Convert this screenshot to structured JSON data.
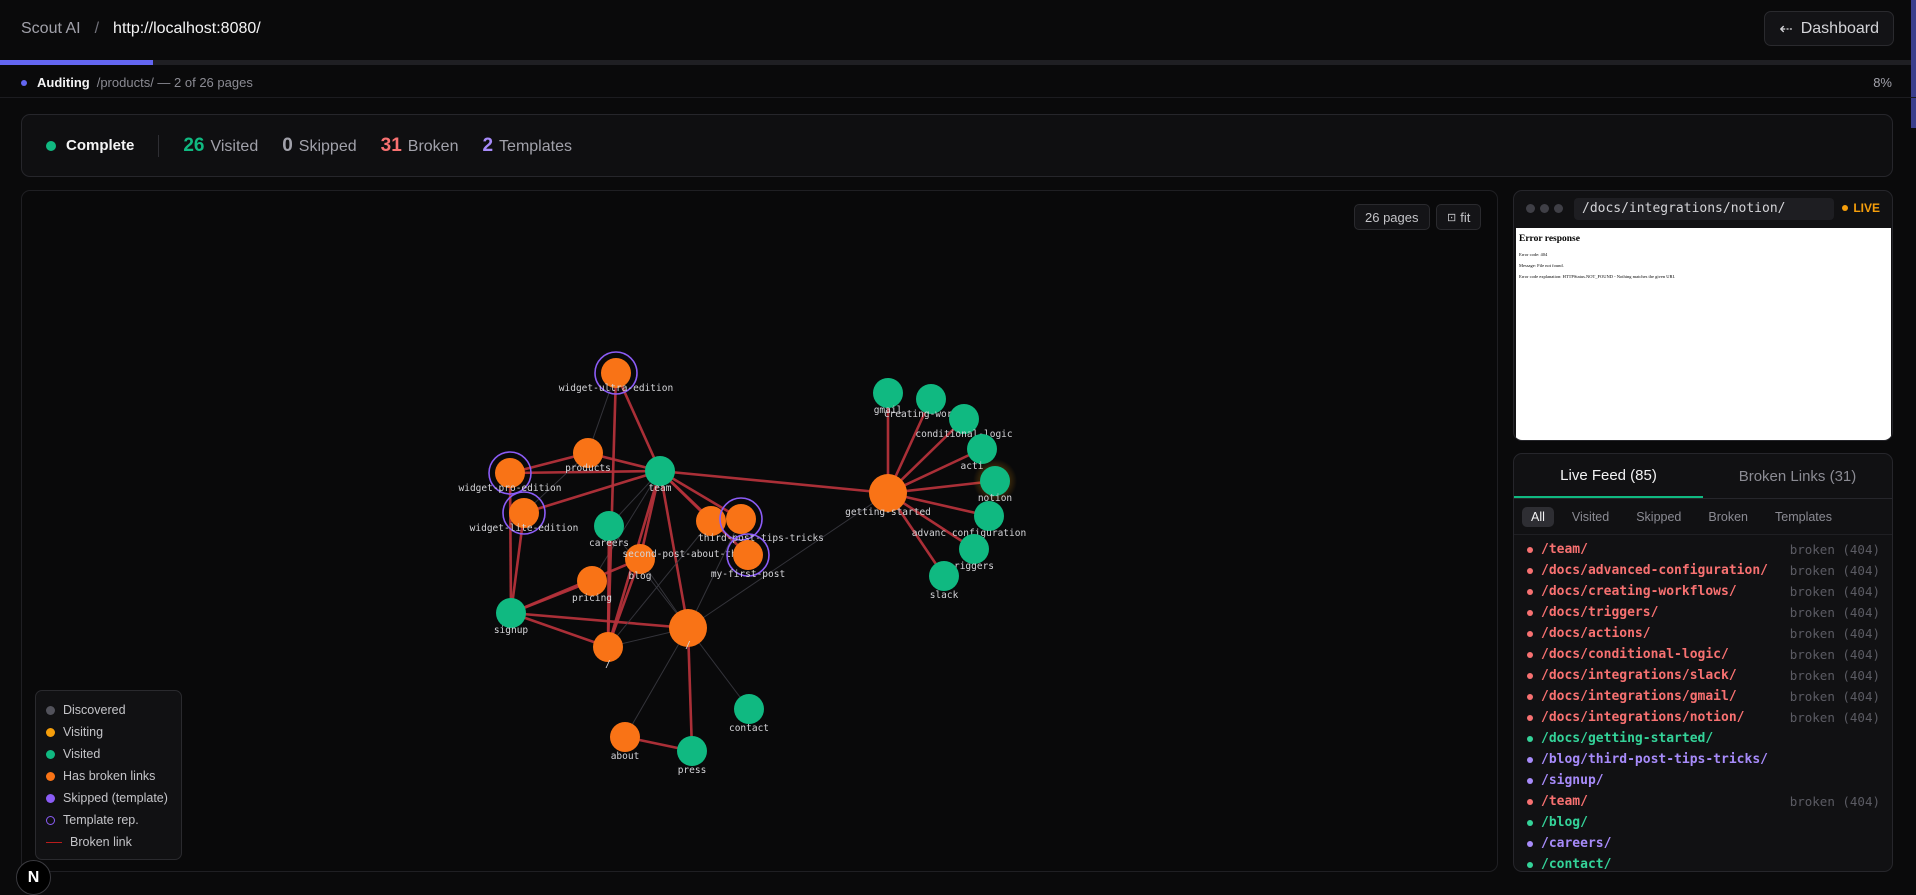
{
  "header": {
    "app": "Scout AI",
    "sep": "/",
    "url": "http://localhost:8080/",
    "dashboard_label": "Dashboard",
    "progress_fraction": 0.08
  },
  "audit": {
    "label": "Auditing",
    "path": "/products/ — 2 of 26 pages",
    "percent": "8%"
  },
  "stats": {
    "status": "Complete",
    "items": [
      {
        "num": "26",
        "label": "Visited",
        "color": "#10b981"
      },
      {
        "num": "0",
        "label": "Skipped",
        "color": "#a1a1aa"
      },
      {
        "num": "31",
        "label": "Broken",
        "color": "#f87171"
      },
      {
        "num": "2",
        "label": "Templates",
        "color": "#a78bfa"
      }
    ]
  },
  "graph": {
    "pages_label": "26 pages",
    "fit_label": "fit",
    "nodes": [
      {
        "id": "widget-ultra-edition",
        "kind": "broken",
        "template": true
      },
      {
        "id": "products",
        "kind": "broken"
      },
      {
        "id": "team",
        "kind": "visited"
      },
      {
        "id": "widget-pro-edition",
        "kind": "broken",
        "template": true
      },
      {
        "id": "widget-lite-edition",
        "kind": "broken",
        "template": true
      },
      {
        "id": "careers",
        "kind": "visited"
      },
      {
        "id": "blog",
        "kind": "broken"
      },
      {
        "id": "second-post-about-things",
        "kind": "broken"
      },
      {
        "id": "third-post-tips-tricks",
        "kind": "broken",
        "template": true
      },
      {
        "id": "my-first-post",
        "kind": "broken",
        "template": true
      },
      {
        "id": "pricing",
        "kind": "broken"
      },
      {
        "id": "signup",
        "kind": "visited"
      },
      {
        "id": "/",
        "kind": "broken"
      },
      {
        "id": "/root",
        "display": "/",
        "kind": "broken"
      },
      {
        "id": "contact",
        "kind": "visited"
      },
      {
        "id": "about",
        "kind": "broken"
      },
      {
        "id": "press",
        "kind": "visited"
      },
      {
        "id": "getting-started",
        "kind": "broken"
      },
      {
        "id": "gmail",
        "kind": "visited"
      },
      {
        "id": "creating-workflows",
        "display": "creating-work",
        "kind": "visited"
      },
      {
        "id": "conditional-logic",
        "kind": "visited"
      },
      {
        "id": "actions",
        "display": "acti",
        "kind": "visited"
      },
      {
        "id": "notion",
        "kind": "visited",
        "live": true
      },
      {
        "id": "advanced-configuration",
        "display": "advanc   configuration",
        "kind": "visited"
      },
      {
        "id": "triggers",
        "display": "riggers",
        "kind": "visited"
      },
      {
        "id": "slack",
        "kind": "visited"
      }
    ],
    "legend": [
      {
        "label": "Discovered",
        "color": "#52525b",
        "type": "dot"
      },
      {
        "label": "Visiting",
        "color": "#f59e0b",
        "type": "dot"
      },
      {
        "label": "Visited",
        "color": "#10b981",
        "type": "dot"
      },
      {
        "label": "Has broken links",
        "color": "#f97316",
        "type": "dot"
      },
      {
        "label": "Skipped (template)",
        "color": "#8b5cf6",
        "type": "dot"
      },
      {
        "label": "Template rep.",
        "color": "#8b5cf6",
        "type": "ring"
      },
      {
        "label": "Broken link",
        "color": "#b91c1c",
        "type": "line"
      }
    ]
  },
  "preview": {
    "url": "/docs/integrations/notion/",
    "live": "LIVE",
    "heading": "Error response",
    "lines": [
      "Error code: 404",
      "Message: File not found.",
      "Error code explanation: HTTPStatus.NOT_FOUND - Nothing matches the given URI."
    ]
  },
  "feed": {
    "tabs": [
      "Live Feed (85)",
      "Broken Links (31)"
    ],
    "filters": [
      "All",
      "Visited",
      "Skipped",
      "Broken",
      "Templates"
    ],
    "rows": [
      {
        "path": "/team/",
        "status": "broken (404)",
        "kind": "broken"
      },
      {
        "path": "/docs/advanced-configuration/",
        "status": "broken (404)",
        "kind": "broken"
      },
      {
        "path": "/docs/creating-workflows/",
        "status": "broken (404)",
        "kind": "broken"
      },
      {
        "path": "/docs/triggers/",
        "status": "broken (404)",
        "kind": "broken"
      },
      {
        "path": "/docs/actions/",
        "status": "broken (404)",
        "kind": "broken"
      },
      {
        "path": "/docs/conditional-logic/",
        "status": "broken (404)",
        "kind": "broken"
      },
      {
        "path": "/docs/integrations/slack/",
        "status": "broken (404)",
        "kind": "broken"
      },
      {
        "path": "/docs/integrations/gmail/",
        "status": "broken (404)",
        "kind": "broken"
      },
      {
        "path": "/docs/integrations/notion/",
        "status": "broken (404)",
        "kind": "broken"
      },
      {
        "path": "/docs/getting-started/",
        "status": "",
        "kind": "visited"
      },
      {
        "path": "/blog/third-post-tips-tricks/",
        "status": "",
        "kind": "template"
      },
      {
        "path": "/signup/",
        "status": "",
        "kind": "template"
      },
      {
        "path": "/team/",
        "status": "broken (404)",
        "kind": "broken"
      },
      {
        "path": "/blog/",
        "status": "",
        "kind": "visited"
      },
      {
        "path": "/careers/",
        "status": "",
        "kind": "template"
      },
      {
        "path": "/contact/",
        "status": "",
        "kind": "visited"
      }
    ]
  },
  "colors": {
    "broken_node": "#f97316",
    "visited_node": "#10b981",
    "template_ring": "#8b5cf6",
    "broken_edge": "#b3323a",
    "edge": "#3f3f46",
    "broken_text": "#f87171",
    "visited_text": "#34d399",
    "template_text": "#a78bfa"
  }
}
